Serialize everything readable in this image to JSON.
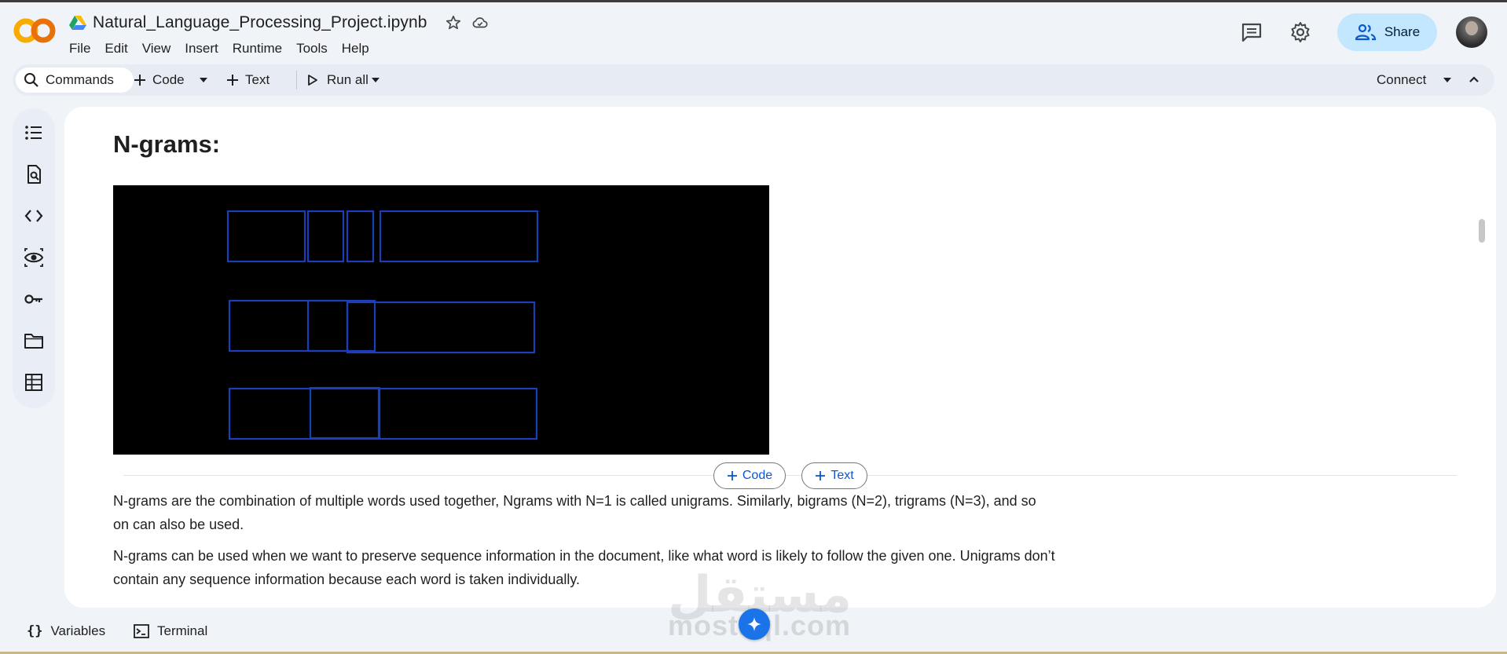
{
  "colors": {
    "accent": "#0b57d0",
    "share_bg": "#c2e7ff",
    "figure_bg": "#000000",
    "figure_stroke": "#1a3fb8"
  },
  "app": {
    "logo_icon": "colab-logo-icon",
    "drive_icon": "google-drive-icon",
    "doc_title": "Natural_Language_Processing_Project.ipynb",
    "star_icon": "star-icon",
    "cloud_icon": "cloud-saved-icon"
  },
  "menu": [
    "File",
    "Edit",
    "View",
    "Insert",
    "Runtime",
    "Tools",
    "Help"
  ],
  "header_right": {
    "comments_icon": "comment-icon",
    "settings_icon": "gear-icon",
    "share_label": "Share",
    "share_icon": "people-icon"
  },
  "toolbar": {
    "commands_label": "Commands",
    "code_label": "Code",
    "text_label": "Text",
    "run_all_label": "Run all",
    "connect_label": "Connect"
  },
  "rail": [
    "toc-icon",
    "find-icon",
    "code-snippets-icon",
    "secrets-eye-icon",
    "key-icon",
    "folder-icon",
    "table-icon"
  ],
  "cell": {
    "heading": "N-grams:",
    "add_code_label": "Code",
    "add_text_label": "Text",
    "para1": "N-grams are the combination of multiple words used together, Ngrams with N=1 is called unigrams. Similarly, bigrams (N=2), trigrams (N=3), and so on can also be used.",
    "para2": "N-grams can be used when we want to preserve sequence information in the document, like what word is likely to follow the given one. Unigrams don’t contain any sequence information because each word is taken individually."
  },
  "bottom": {
    "variables_label": "Variables",
    "terminal_label": "Terminal"
  },
  "watermark": {
    "arabic": "مستقل",
    "latin": "mostaql.com"
  }
}
